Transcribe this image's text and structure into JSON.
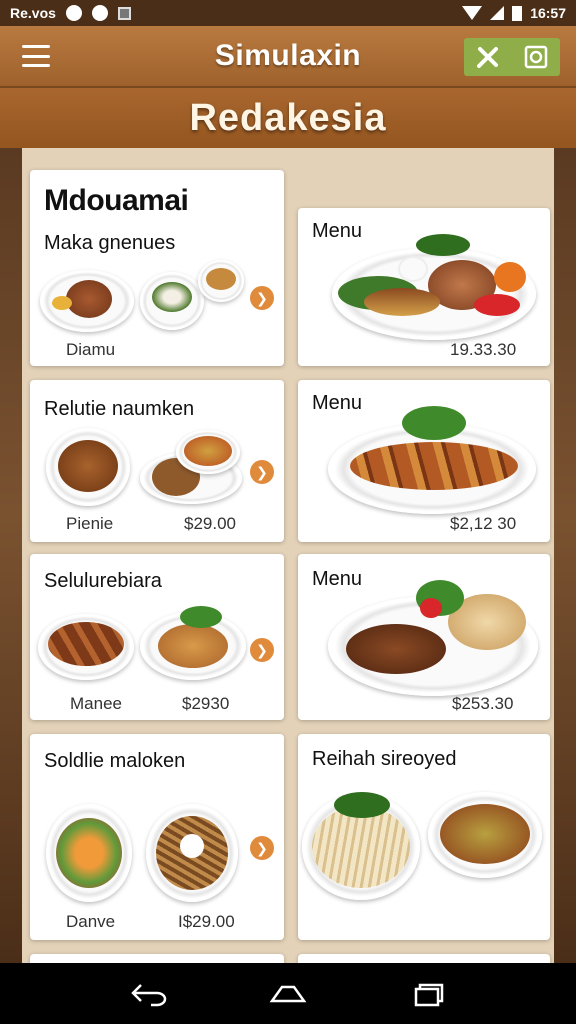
{
  "status_bar": {
    "left_text": "Re.vos",
    "time": "16:57"
  },
  "app_bar": {
    "title": "Simulaxin"
  },
  "banner": {
    "title": "Redakesia"
  },
  "cards": [
    {
      "title": "Mdouamai",
      "subtitle": "Maka gnenues",
      "footer_left": "Diamu",
      "footer_right": ""
    },
    {
      "title": "Menu",
      "subtitle": "",
      "footer_left": "",
      "footer_right": "19.33.30"
    },
    {
      "title": "Relutie naumken",
      "subtitle": "",
      "footer_left": "Pienie",
      "footer_right": "$29.00"
    },
    {
      "title": "Menu",
      "subtitle": "",
      "footer_left": "",
      "footer_right": "$2,12 30"
    },
    {
      "title": "Selulurebiara",
      "subtitle": "",
      "footer_left": "Manee",
      "footer_right": "$2930"
    },
    {
      "title": "Menu",
      "subtitle": "",
      "footer_left": "",
      "footer_right": "$253.30"
    },
    {
      "title": "Soldlie maloken",
      "subtitle": "",
      "footer_left": "Danve",
      "footer_right": "I$29.00"
    },
    {
      "title": "Reihah sireoyed",
      "subtitle": "",
      "footer_left": "",
      "footer_right": ""
    }
  ],
  "badge_glyph": "❯",
  "colors": {
    "app_bar": "#a86a32",
    "accent_green": "#8fae4a",
    "badge": "#e08a3c",
    "panel": "#e3d2b8"
  }
}
